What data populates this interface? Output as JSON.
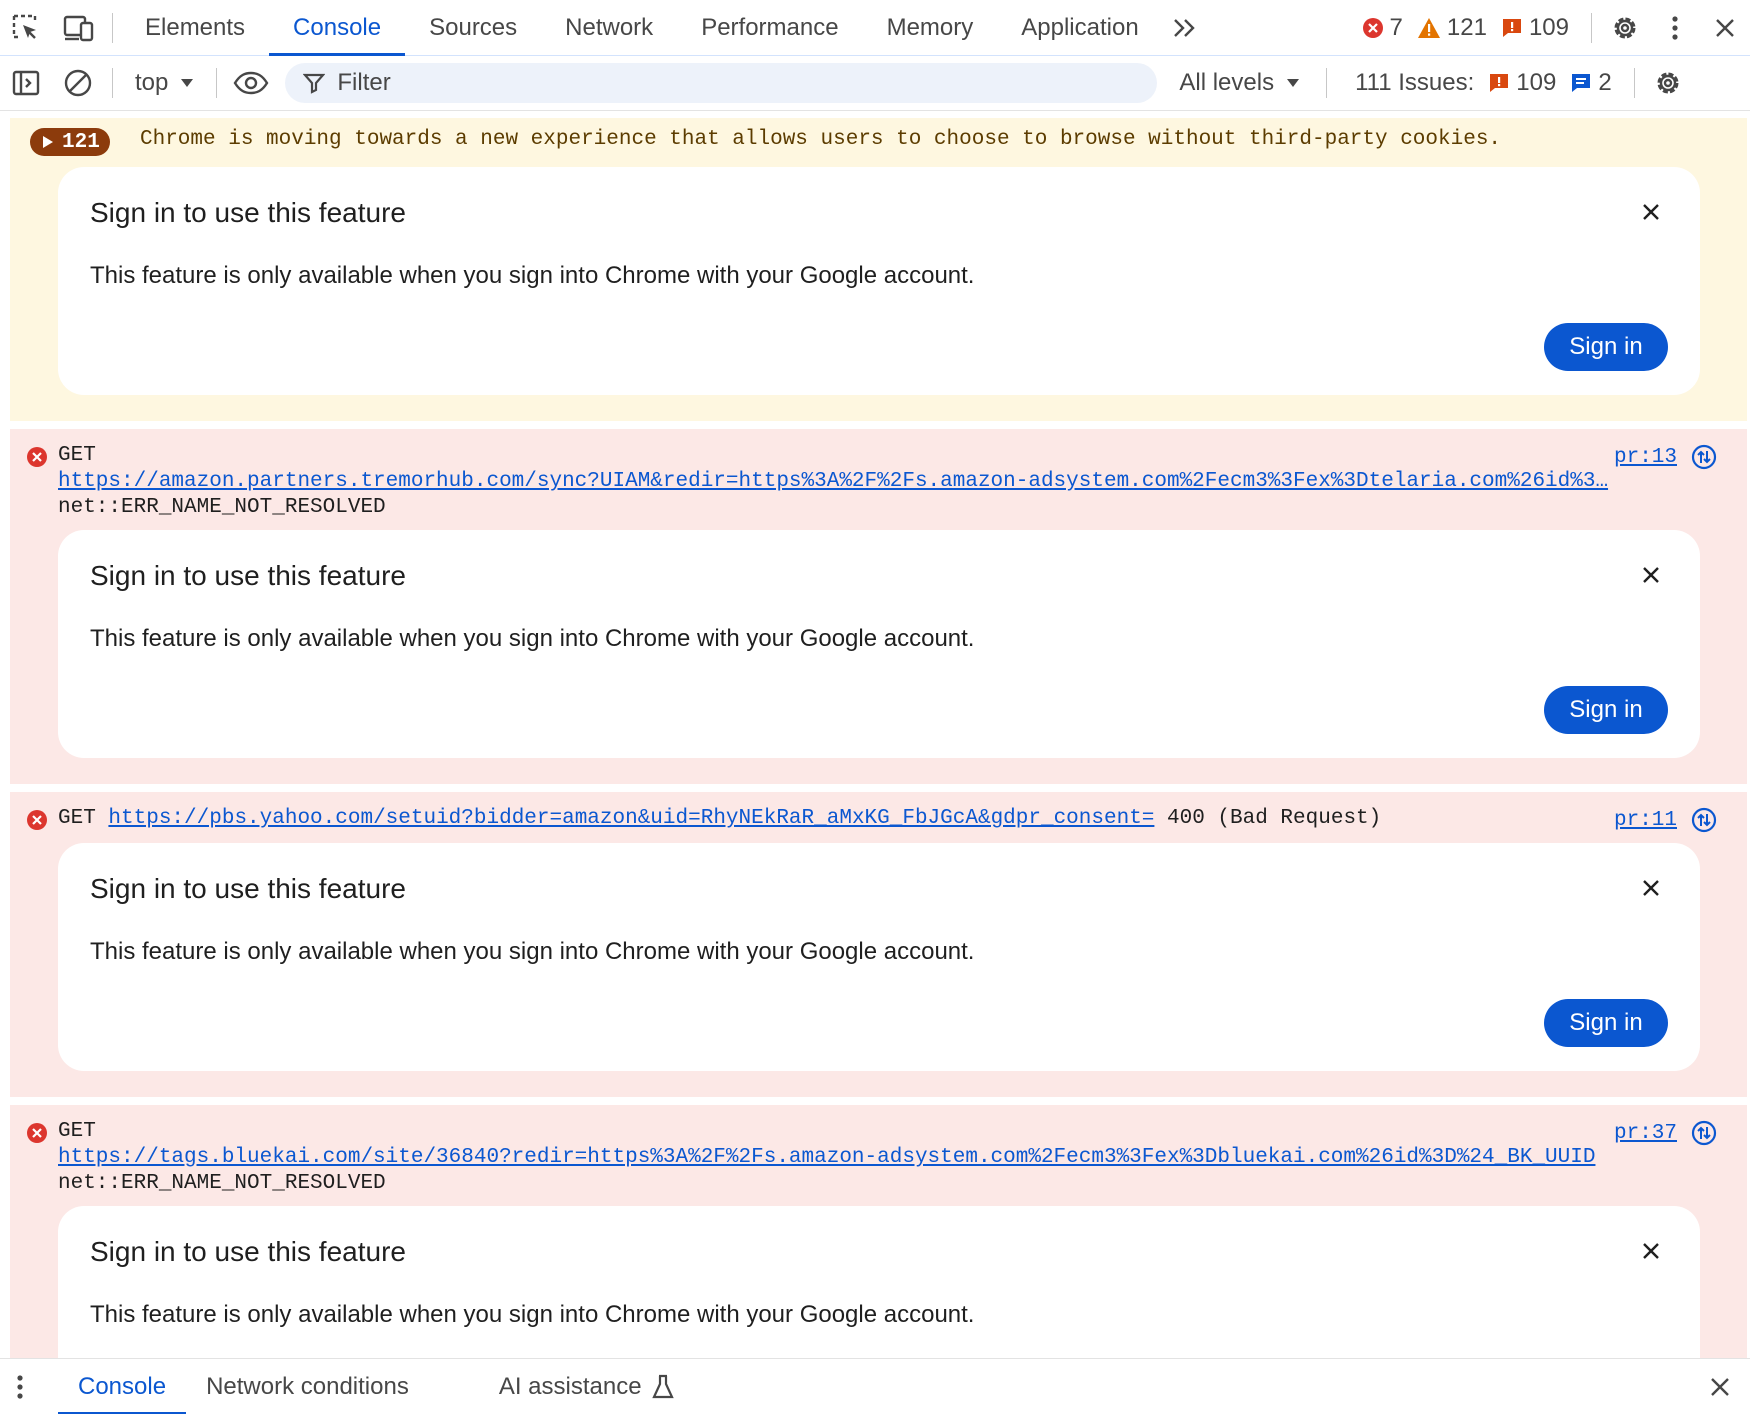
{
  "tabs": [
    {
      "label": "Elements"
    },
    {
      "label": "Console",
      "active": true
    },
    {
      "label": "Sources"
    },
    {
      "label": "Network"
    },
    {
      "label": "Performance"
    },
    {
      "label": "Memory"
    },
    {
      "label": "Application"
    }
  ],
  "counters": {
    "errors": "7",
    "warnings": "121",
    "issues": "109"
  },
  "toolbar": {
    "context": "top",
    "filter_placeholder": "Filter",
    "levels": "All levels",
    "issues_label": "111 Issues:",
    "issues_count": "109",
    "info_count": "2"
  },
  "messages": {
    "warning": {
      "count": "121",
      "text": "Chrome is moving towards a new experience that allows users to choose to browse without third-party cookies."
    },
    "error1": {
      "method": "GET",
      "url": "https://amazon.partners.tremorhub.com/sync?UIAM&redir=https%3A%2F%2Fs.amazon-adsystem.com%2Fecm3%3Fex%3Dtelaria.com%26id%3…",
      "detail": "net::ERR_NAME_NOT_RESOLVED",
      "source": "pr:13"
    },
    "error2": {
      "method": "GET",
      "url": "https://pbs.yahoo.com/setuid?bidder=amazon&uid=RhyNEkRaR_aMxKG_FbJGcA&gdpr_consent=",
      "detail": "400 (Bad Request)",
      "source": "pr:11"
    },
    "error3": {
      "method": "GET",
      "url": "https://tags.bluekai.com/site/36840?redir=https%3A%2F%2Fs.amazon-adsystem.com%2Fecm3%3Fex%3Dbluekai.com%26id%3D%24_BK_UUID",
      "detail": "net::ERR_NAME_NOT_RESOLVED",
      "source": "pr:37"
    }
  },
  "signin_card": {
    "title": "Sign in to use this feature",
    "description": "This feature is only available when you sign into Chrome with your Google account.",
    "button": "Sign in"
  },
  "drawer": {
    "tabs": [
      {
        "label": "Console",
        "active": true
      },
      {
        "label": "Network conditions"
      },
      {
        "label": "AI assistance"
      }
    ]
  },
  "colors": {
    "accent": "#0b57d0",
    "warning_bg": "#fef7e0",
    "error_bg": "#fce8e6",
    "error_icon": "#dc362e",
    "warning_icon": "#e37400"
  }
}
